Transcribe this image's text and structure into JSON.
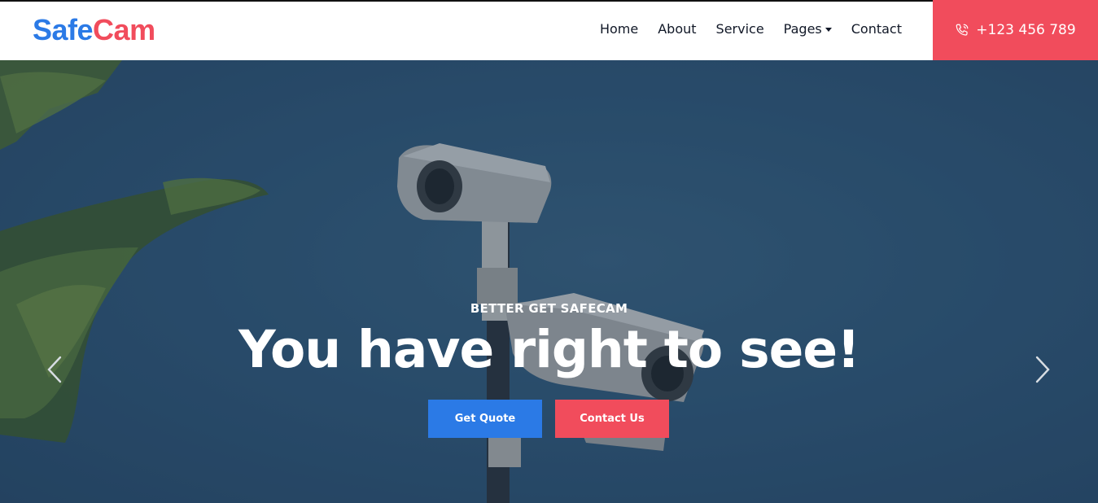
{
  "brand": {
    "part1": "Safe",
    "part2": "Cam"
  },
  "nav": {
    "home": "Home",
    "about": "About",
    "service": "Service",
    "pages": "Pages",
    "contact": "Contact"
  },
  "phone": {
    "number": "+123 456 789",
    "icon": "phone-icon"
  },
  "hero": {
    "eyebrow": "BETTER GET SAFECAM",
    "headline": "You have right to see!",
    "get_quote": "Get Quote",
    "contact_us": "Contact Us",
    "prev_icon": "chevron-left-icon",
    "next_icon": "chevron-right-icon"
  },
  "colors": {
    "primary": "#2b7ae6",
    "accent": "#f14c5c",
    "hero_bg": "#2f5575"
  }
}
